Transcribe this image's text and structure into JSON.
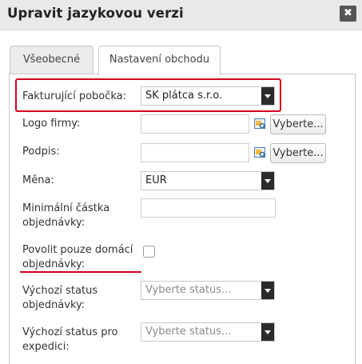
{
  "dialog": {
    "title": "Upravit jazykovou verzi",
    "close_label": "✖"
  },
  "tabs": [
    {
      "label": "Všeobecné",
      "active": false
    },
    {
      "label": "Nastavení obchodu",
      "active": true
    }
  ],
  "form": {
    "billing_branch": {
      "label": "Fakturující pobočka:",
      "value": "SK plátca s.r.o."
    },
    "logo": {
      "label": "Logo firmy:",
      "value": "",
      "browse_label": "Vyberte..."
    },
    "signature": {
      "label": "Podpis:",
      "value": "",
      "browse_label": "Vyberte..."
    },
    "currency": {
      "label": "Měna:",
      "value": "EUR"
    },
    "min_order": {
      "label_line1": "Minimální částka",
      "label_line2": "objednávky:",
      "value": ""
    },
    "domestic_only": {
      "label_line1": "Povolit pouze domácí",
      "label_line2": "objednávky:",
      "checked": false
    },
    "default_order_status": {
      "label_line1": "Výchozí status",
      "label_line2": "objednávky:",
      "placeholder": "Vyberte status..."
    },
    "default_dispatch_status": {
      "label_line1": "Výchozí status pro",
      "label_line2": "expedici:",
      "placeholder": "Vyberte status..."
    }
  },
  "colors": {
    "annotation": "#d9001b",
    "select_arrow_bg": "#2b2b2b",
    "titlebar_bg": "#e9e9e9"
  },
  "icons": {
    "browse": "image-browse-icon",
    "close": "close-icon",
    "dropdown": "chevron-down-icon"
  }
}
